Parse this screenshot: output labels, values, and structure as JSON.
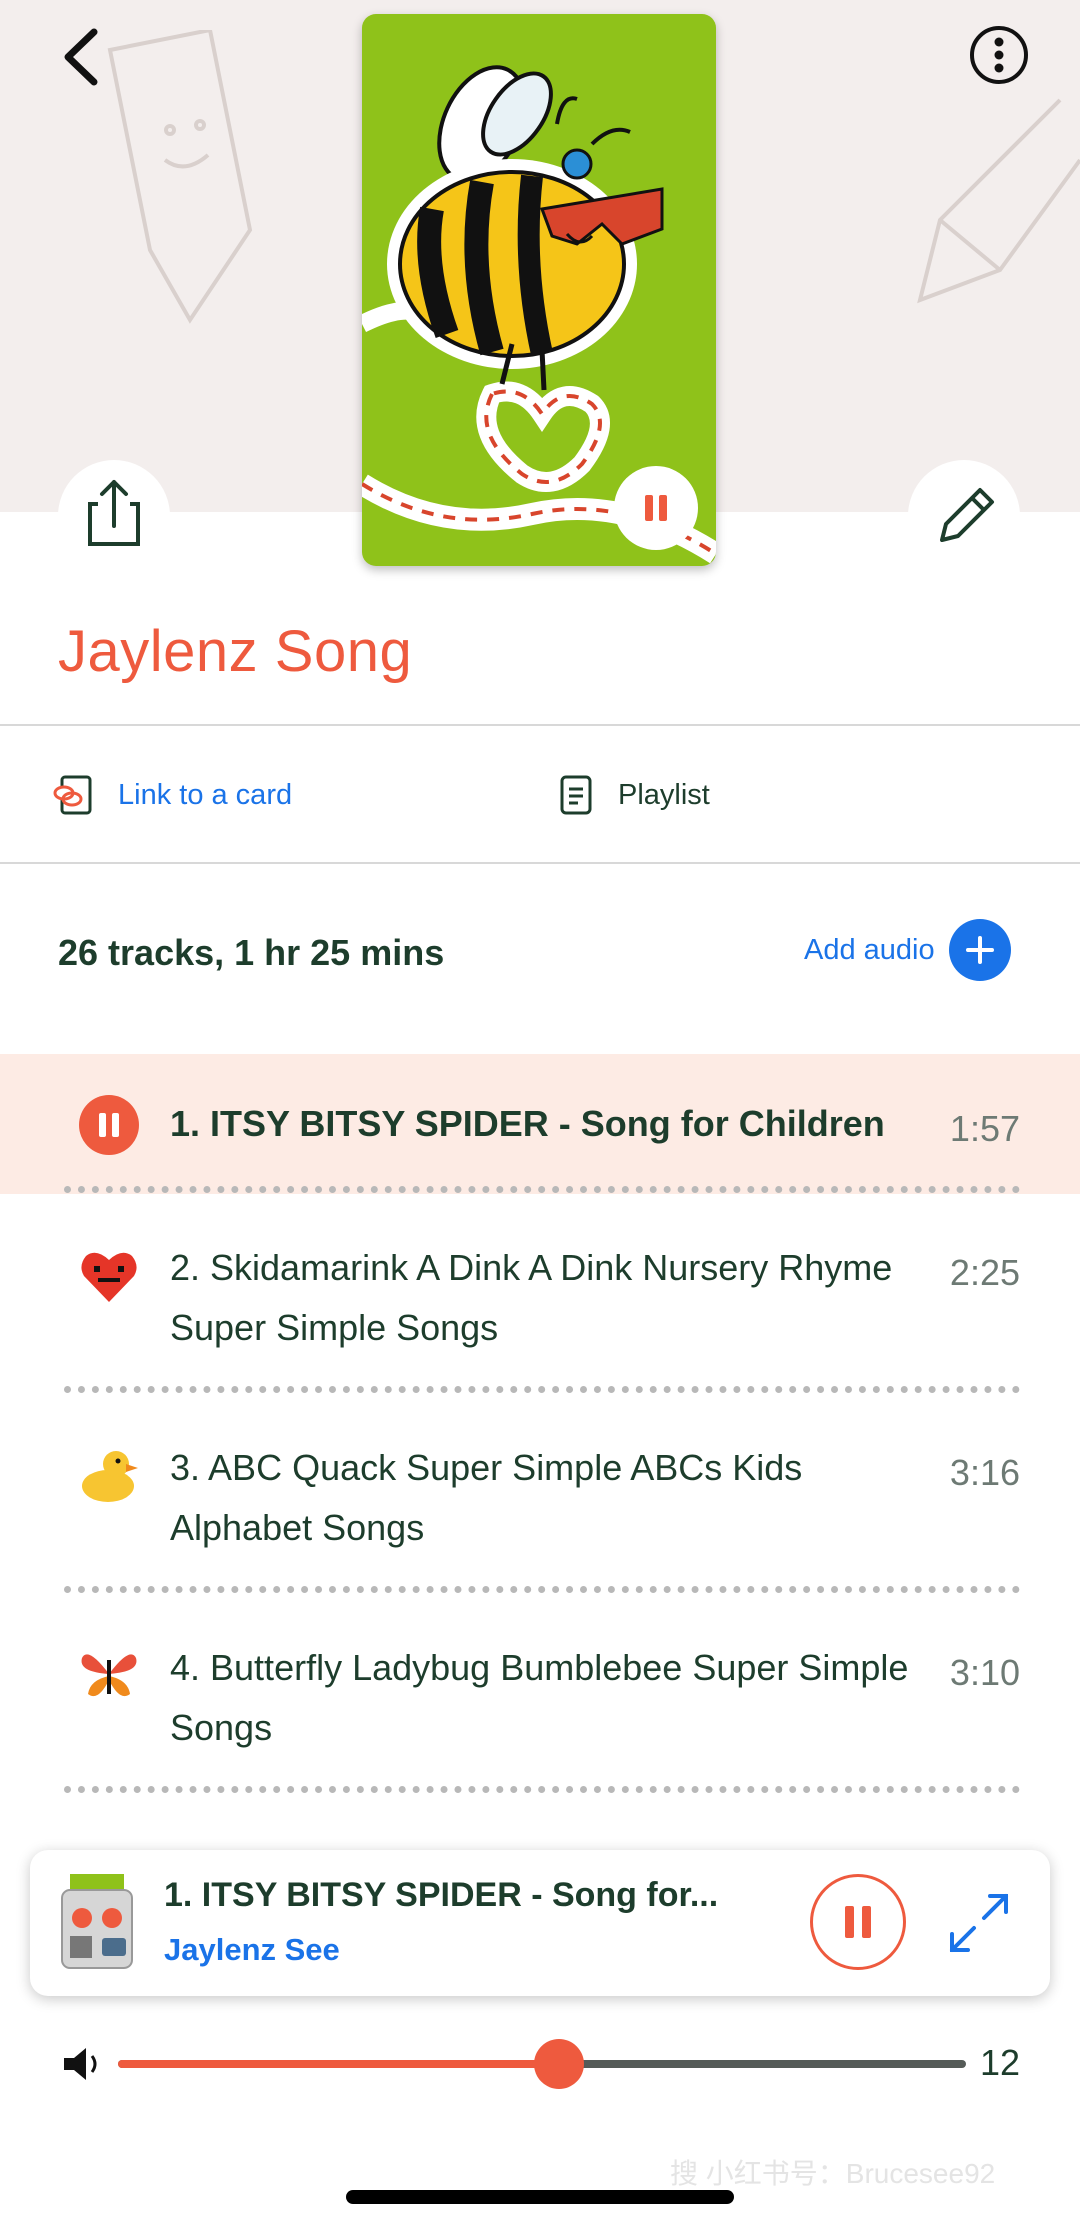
{
  "playlist": {
    "title": "Jaylenz Song",
    "link_to_card": "Link to a card",
    "playlist_label": "Playlist",
    "summary": "26 tracks, 1 hr 25 mins",
    "add_audio": "Add audio"
  },
  "tracks": [
    {
      "title": "1. ITSY BITSY SPIDER - Song for Children",
      "duration": "1:57",
      "icon": "pause-icon",
      "playing": true
    },
    {
      "title": "2. Skidamarink A Dink A Dink  Nursery Rhyme  Super Simple Songs",
      "duration": "2:25",
      "icon": "heart-icon"
    },
    {
      "title": "3. ABC Quack  Super Simple ABCs  Kids Alphabet Songs",
      "duration": "3:16",
      "icon": "duck-icon"
    },
    {
      "title": "4. Butterfly Ladybug Bumblebee  Super Simple Songs",
      "duration": "3:10",
      "icon": "butterfly-icon"
    }
  ],
  "now_playing": {
    "title": "1. ITSY BITSY SPIDER - Song for...",
    "artist": "Jaylenz See"
  },
  "volume": {
    "value": "12",
    "level": 0.52
  },
  "watermark": "搜 小红书号：Brucesee92",
  "colors": {
    "accent": "#ee5a3e",
    "link": "#1a73e8",
    "text": "#1d3d2c",
    "active_row": "#fdebe4",
    "cover": "#8fc21a"
  }
}
